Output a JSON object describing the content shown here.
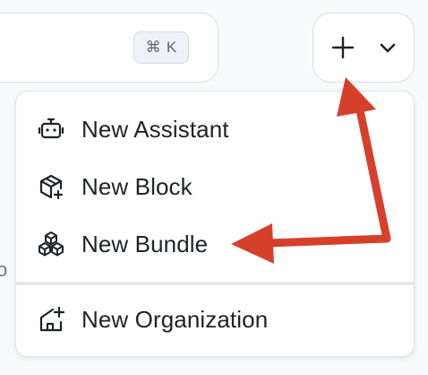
{
  "search": {
    "shortcut_symbol": "⌘",
    "shortcut_key": "K"
  },
  "toolbar": {
    "plus_icon": "plus-icon",
    "chevron_icon": "chevron-down-icon"
  },
  "menu": {
    "items": [
      {
        "label": "New Assistant",
        "icon": "robot-icon"
      },
      {
        "label": "New Block",
        "icon": "cube-plus-icon"
      },
      {
        "label": "New Bundle",
        "icon": "cubes-icon"
      },
      {
        "label": "New Organization",
        "icon": "building-plus-icon"
      }
    ]
  },
  "annotation": {
    "arrow_color": "#d6402b"
  },
  "background": {
    "stray_char": "o"
  }
}
